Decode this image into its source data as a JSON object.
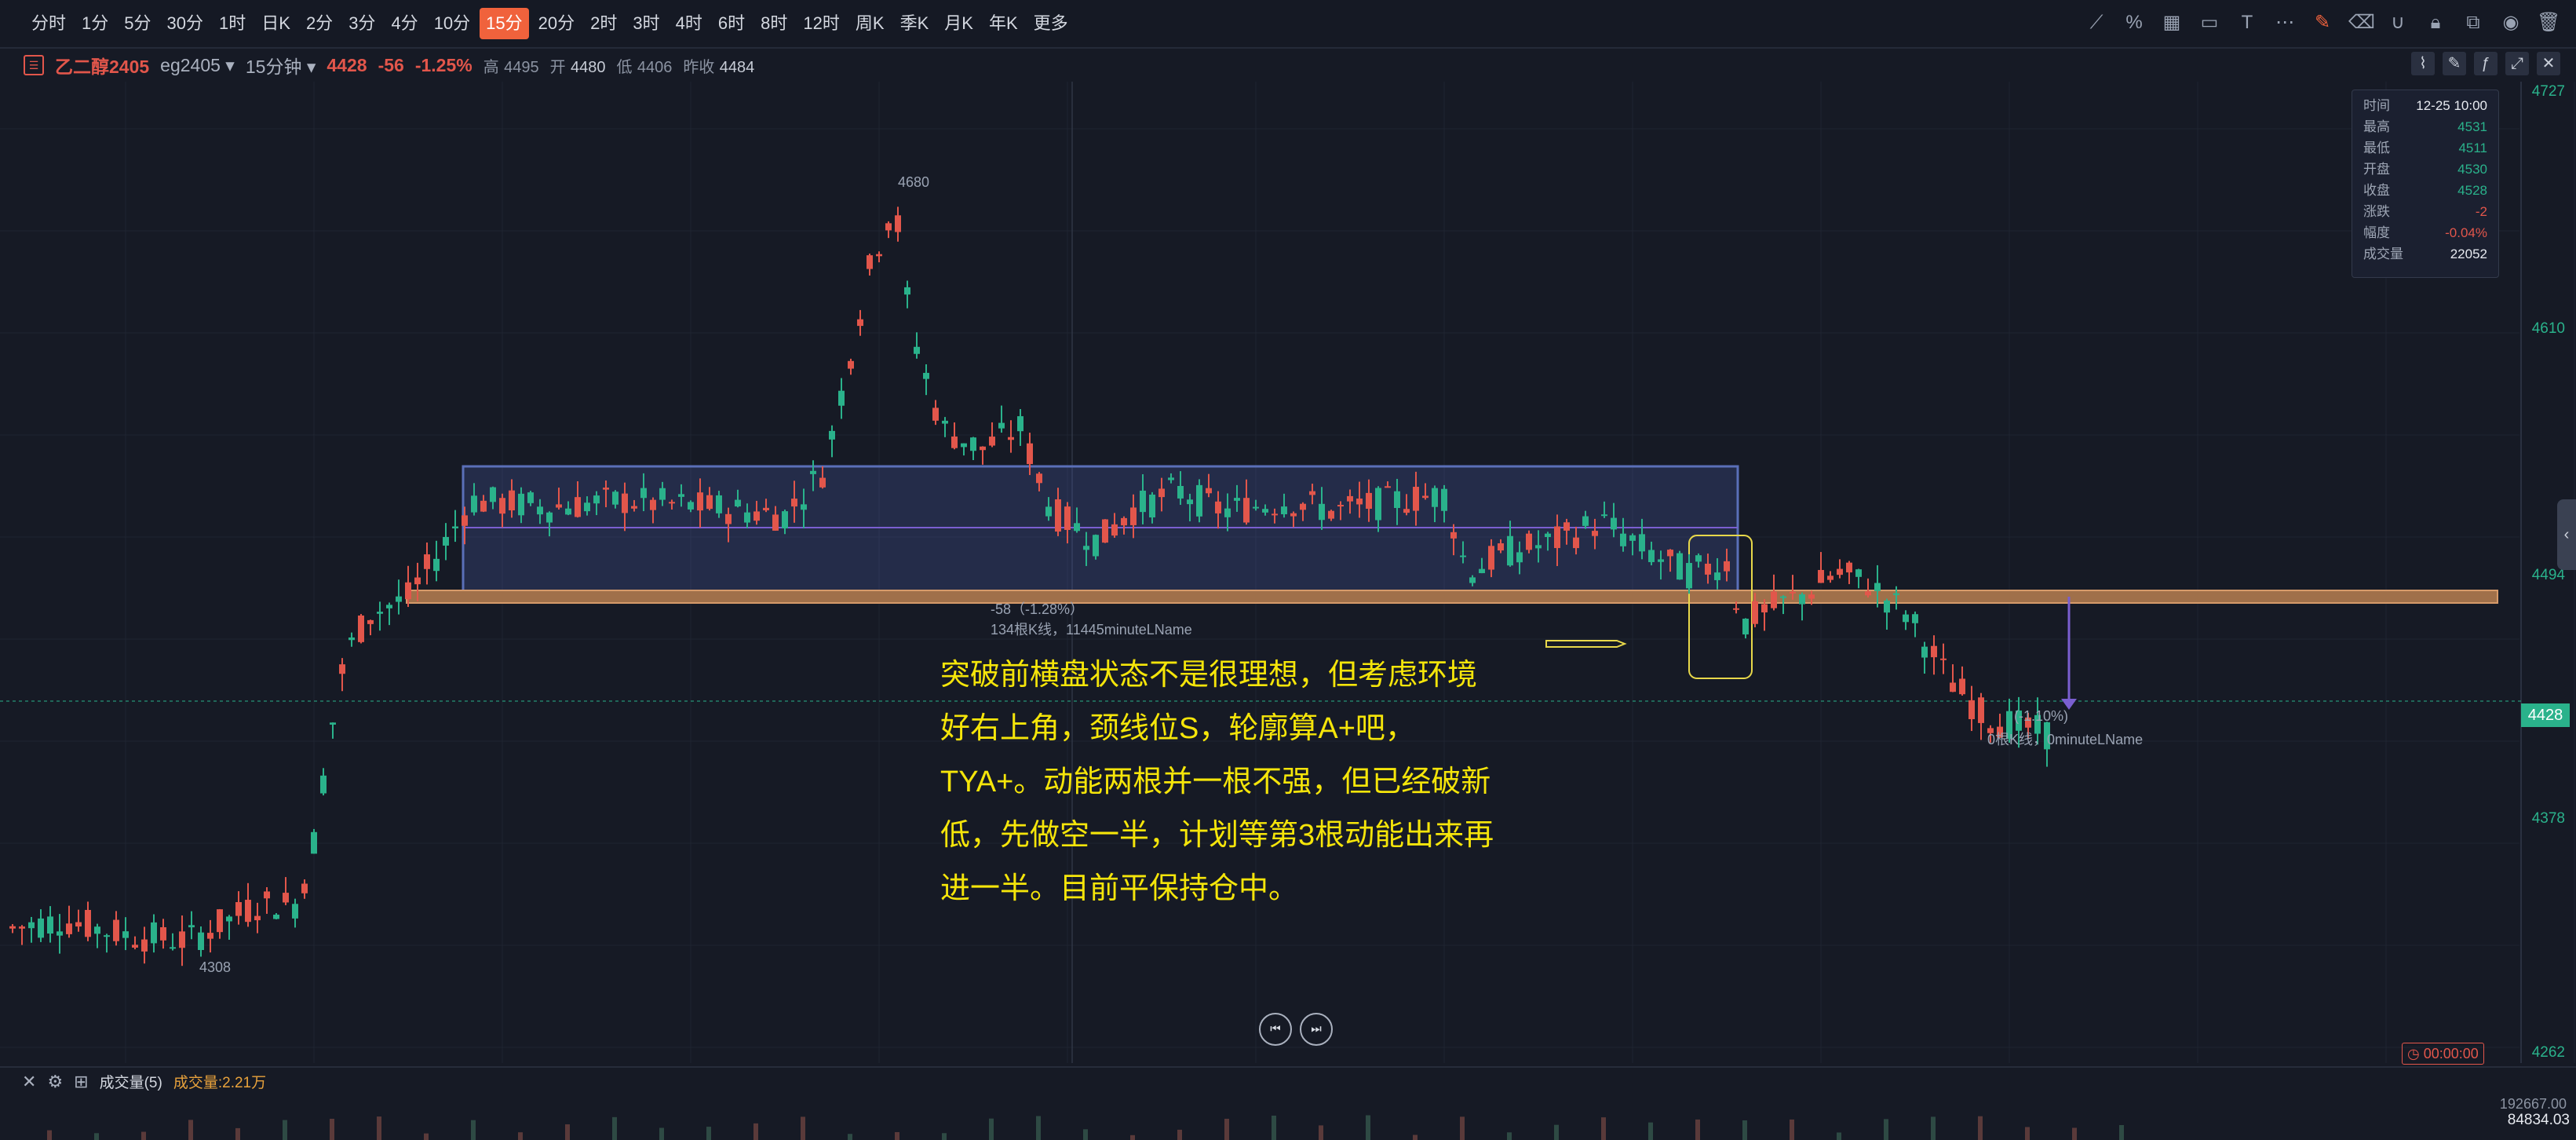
{
  "toolbar": {
    "periods": [
      "分时",
      "1分",
      "5分",
      "30分",
      "1时",
      "日K",
      "2分",
      "3分",
      "4分",
      "10分",
      "15分",
      "20分",
      "2时",
      "3时",
      "4时",
      "6时",
      "8时",
      "12时",
      "周K",
      "季K",
      "月K",
      "年K",
      "更多"
    ],
    "active_period": "15分"
  },
  "symbol": {
    "name": "乙二醇2405",
    "code": "eg2405",
    "interval": "15分钟",
    "price": "4428",
    "change": "-56",
    "change_pct": "-1.25%",
    "high_label": "高",
    "high": "4495",
    "open_label": "开",
    "open": "4480",
    "low_label": "低",
    "low": "4406",
    "prev_close_label": "昨收",
    "prev_close": "4484"
  },
  "ohlc_popup": {
    "rows": [
      {
        "k": "时间",
        "v": "12-25 10:00"
      },
      {
        "k": "最高",
        "v": "4531"
      },
      {
        "k": "最低",
        "v": "4511"
      },
      {
        "k": "开盘",
        "v": "4530"
      },
      {
        "k": "收盘",
        "v": "4528"
      },
      {
        "k": "涨跌",
        "v": "-2"
      },
      {
        "k": "幅度",
        "v": "-0.04%"
      },
      {
        "k": "成交量",
        "v": "22052"
      }
    ]
  },
  "price_axis": {
    "labels": [
      "4727",
      "4610",
      "4494",
      "4378",
      "4262"
    ],
    "current": "4428"
  },
  "chart_marks": {
    "peak_label": "4680",
    "trough_label": "4308",
    "measure1_line1": "-58（-1.28%）",
    "measure1_line2": "134根K线，11445minuteLName",
    "measure2_line1": "(-1.10%)",
    "measure2_line2": "0根K线，0minuteLName"
  },
  "annotation": {
    "lines": [
      "突破前横盘状态不是很理想，但考虑环境",
      "好右上角，颈线位S，轮廓算A+吧，",
      "TYA+。动能两根并一根不强，但已经破新",
      "低，先做空一半，计划等第3根动能出来再",
      "进一半。目前平保持仓中。"
    ]
  },
  "playback": {
    "timer": "00:00:00"
  },
  "volume": {
    "indicator": "成交量(5)",
    "value": "成交量:2.21万",
    "axis_top": "192667.00",
    "axis_value": "84834.03"
  },
  "colors": {
    "up": "#e2564b",
    "down": "#2ab28b",
    "accent": "#f0623c",
    "annotation": "#f5e50a"
  }
}
